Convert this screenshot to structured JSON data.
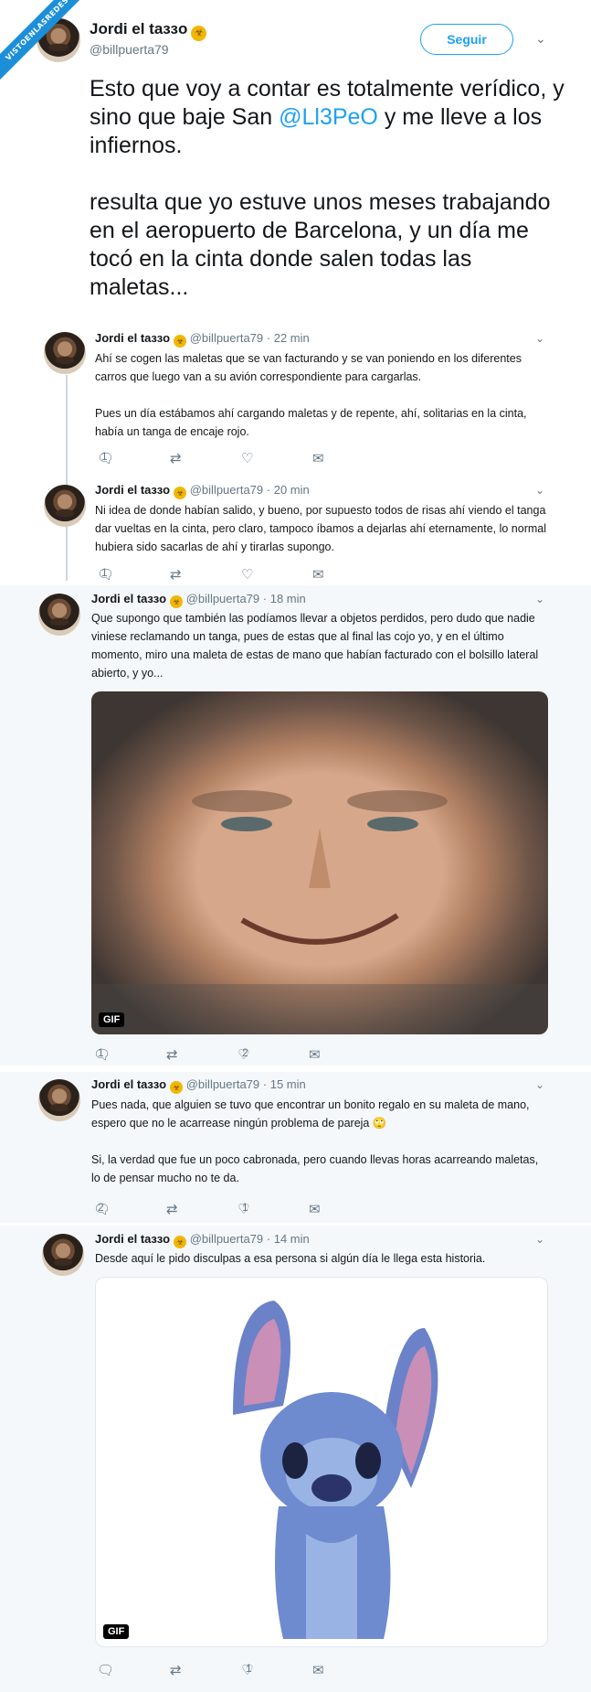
{
  "watermark": "VISTOENLASREDES",
  "author": {
    "name": "Jordi el taззo",
    "handle": "@billpuerta79",
    "badge": "biohazard-icon"
  },
  "follow_label": "Seguir",
  "main_tweet": {
    "paragraphs": [
      {
        "before": "Esto que voy a contar es totalmente verídico, y sino que baje San ",
        "mention": "@Ll3PeO",
        "after": " y me lleve a los infiernos."
      },
      {
        "before": "resulta que yo estuve unos meses trabajando en el aeropuerto de Barcelona, y un día me tocó en la cinta donde salen todas las maletas...",
        "mention": "",
        "after": ""
      }
    ]
  },
  "replies": [
    {
      "time": "· 22 min",
      "paragraphs": [
        "Ahí se cogen las maletas que se van facturando y se van poniendo en los diferentes carros que luego van a su avión correspondiente para cargarlas.",
        "Pues un día estábamos ahí cargando maletas y de repente, ahí, solitarias en la cinta, había un tanga de encaje rojo."
      ],
      "replies_count": "1",
      "retweets_count": "",
      "likes_count": ""
    },
    {
      "time": "· 20 min",
      "paragraphs": [
        "Ni idea de donde habían salido, y bueno, por supuesto todos de risas ahí viendo el tanga dar vueltas en la cinta, pero claro, tampoco íbamos a dejarlas ahí eternamente, lo normal hubiera sido sacarlas de ahí y tirarlas supongo."
      ],
      "replies_count": "1",
      "retweets_count": "",
      "likes_count": ""
    },
    {
      "time": "· 18 min",
      "paragraphs": [
        "Que supongo que también las podíamos llevar a objetos perdidos, pero dudo que nadie viniese reclamando un tanga, pues de estas que al final las cojo yo, y en el último momento, miro una maleta de estas de mano que habían facturado con el bolsillo lateral abierto, y yo..."
      ],
      "media": "GIF",
      "replies_count": "1",
      "retweets_count": "",
      "likes_count": "2"
    },
    {
      "time": "· 15 min",
      "paragraphs": [
        "Pues nada, que alguien se tuvo que encontrar un bonito regalo en su maleta de mano, espero que no le acarrease ningún problema de pareja 🙄",
        "Si, la verdad que fue un poco cabronada, pero cuando llevas horas acarreando maletas, lo de pensar mucho no te da."
      ],
      "replies_count": "2",
      "retweets_count": "",
      "likes_count": "1"
    },
    {
      "time": "· 14 min",
      "paragraphs": [
        "Desde aquí le pido disculpas a esa persona si algún día le llega esta historia."
      ],
      "media": "GIF",
      "replies_count": "",
      "retweets_count": "",
      "likes_count": "1"
    }
  ],
  "icons": {
    "reply": "reply-icon",
    "retweet": "retweet-icon",
    "like": "heart-icon",
    "dm": "envelope-icon",
    "more": "chevron-down-icon"
  }
}
